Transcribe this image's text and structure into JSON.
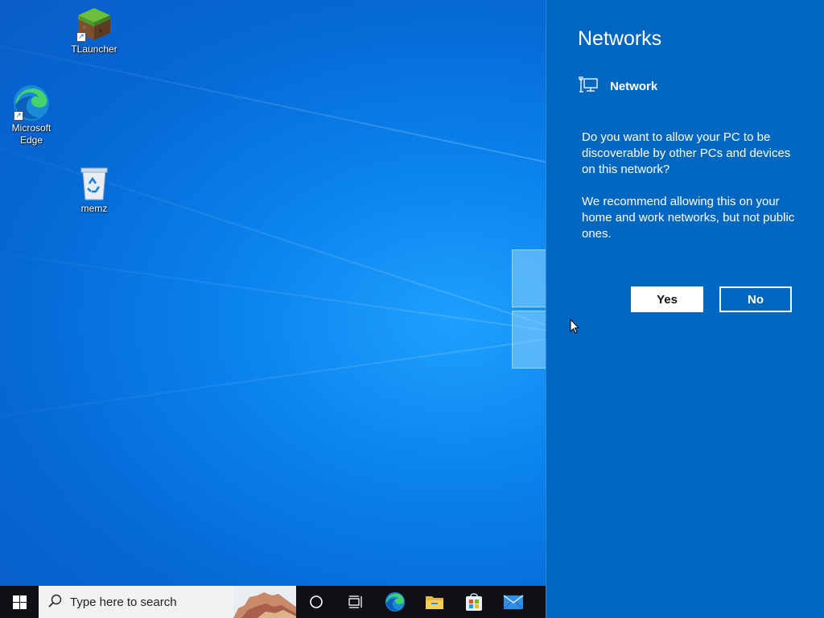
{
  "desktop": {
    "icons": [
      {
        "label": "TLauncher",
        "icon": "minecraft-grass-block-icon"
      },
      {
        "label": "Microsoft Edge",
        "icon": "edge-icon"
      },
      {
        "label": "memz",
        "icon": "recycle-bin-icon"
      }
    ]
  },
  "flyout": {
    "title": "Networks",
    "network_name": "Network",
    "network_icon": "ethernet-monitor-icon",
    "prompt_question": "Do you want to allow your PC to be discoverable by other PCs and devices on this network?",
    "prompt_recommendation": "We recommend allowing this on your home and work networks, but not public ones.",
    "yes_label": "Yes",
    "no_label": "No"
  },
  "taskbar": {
    "search_placeholder": "Type here to search",
    "pinned": [
      "cortana-circle-icon",
      "task-view-icon",
      "edge-icon",
      "file-explorer-icon",
      "store-icon",
      "mail-icon"
    ]
  },
  "colors": {
    "flyout_bg": "#0067c0",
    "taskbar_bg": "#0f0f14",
    "accent": "#0078d7"
  }
}
